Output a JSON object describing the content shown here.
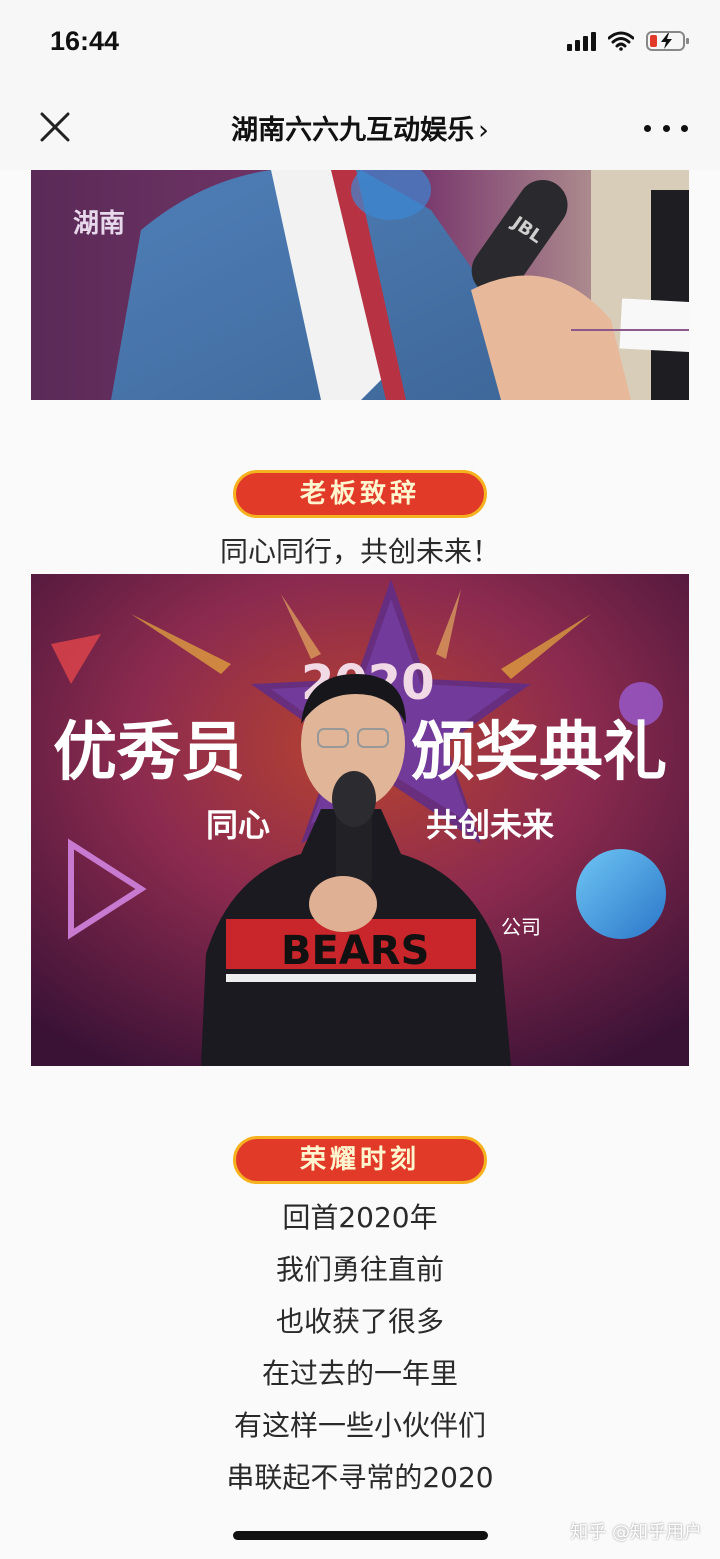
{
  "status": {
    "time": "16:44"
  },
  "nav": {
    "title": "湖南六六九互动娱乐",
    "chevron": "›"
  },
  "section1": {
    "badge": "老板致辞",
    "caption": "同心同行，共创未来！"
  },
  "banner": {
    "year": "2020",
    "title_left": "优秀员",
    "title_right": "颁奖典礼",
    "subtitle_left": "同心",
    "subtitle_right": "共创未来",
    "company_tail": "公司",
    "jacket_text": "BEARS"
  },
  "photo1": {
    "side_text": "湖南",
    "mic_brand": "JBL"
  },
  "section2": {
    "badge": "荣耀时刻",
    "lines": [
      "回首2020年",
      "我们勇往直前",
      "也收获了很多",
      "在过去的一年里",
      "有这样一些小伙伴们",
      "串联起不寻常的2020"
    ]
  },
  "watermark": "知乎 @知乎用户"
}
